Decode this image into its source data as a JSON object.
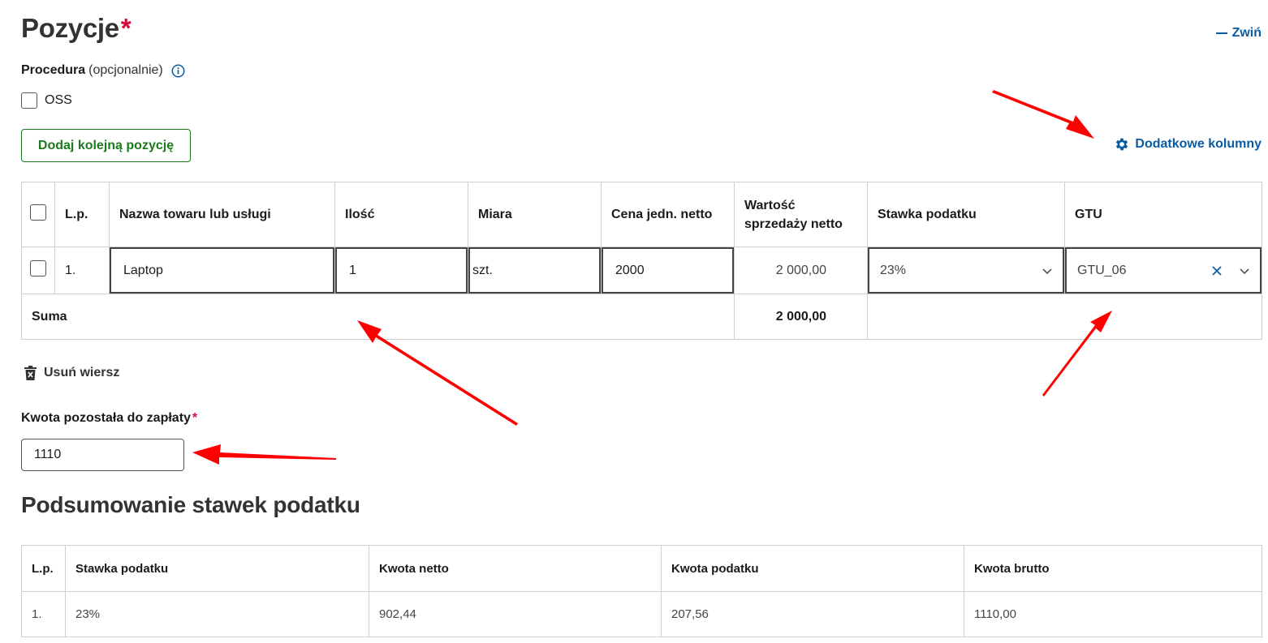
{
  "section": {
    "title": "Pozycje",
    "required_mark": "*",
    "collapse_label": "Zwiń"
  },
  "procedure": {
    "label": "Procedura",
    "optional": "(opcjonalnie)",
    "oss_label": "OSS",
    "oss_checked": false
  },
  "actions": {
    "add_position": "Dodaj kolejną pozycję",
    "extra_columns": "Dodatkowe kolumny",
    "delete_row": "Usuń wiersz"
  },
  "positions_table": {
    "headers": {
      "lp": "L.p.",
      "name": "Nazwa towaru lub usługi",
      "qty": "Ilość",
      "unit": "Miara",
      "price": "Cena jedn. netto",
      "value": "Wartość sprzedaży netto",
      "vat": "Stawka podatku",
      "gtu": "GTU"
    },
    "rows": [
      {
        "lp": "1.",
        "name": "Laptop",
        "qty": "1",
        "unit": "szt.",
        "price": "2000",
        "value": "2 000,00",
        "vat": "23%",
        "gtu": "GTU_06"
      }
    ],
    "sum_label": "Suma",
    "sum_value": "2 000,00"
  },
  "remaining": {
    "label": "Kwota pozostała do zapłaty",
    "required_mark": "*",
    "value": "1110"
  },
  "tax_summary": {
    "title": "Podsumowanie stawek podatku",
    "headers": {
      "lp": "L.p.",
      "rate": "Stawka podatku",
      "net": "Kwota netto",
      "tax": "Kwota podatku",
      "gross": "Kwota brutto"
    },
    "rows": [
      {
        "lp": "1.",
        "rate": "23%",
        "net": "902,44",
        "tax": "207,56",
        "gross": "1110,00"
      }
    ]
  },
  "colors": {
    "accent_blue": "#0b5ba3",
    "green": "#1c7a1c",
    "required_red": "#d40a3b",
    "annotation_red": "#ff0000"
  },
  "icons": [
    "info-icon",
    "gear-icon",
    "trash-icon",
    "clear-x-icon",
    "chevron-down-icon",
    "minus-icon"
  ]
}
